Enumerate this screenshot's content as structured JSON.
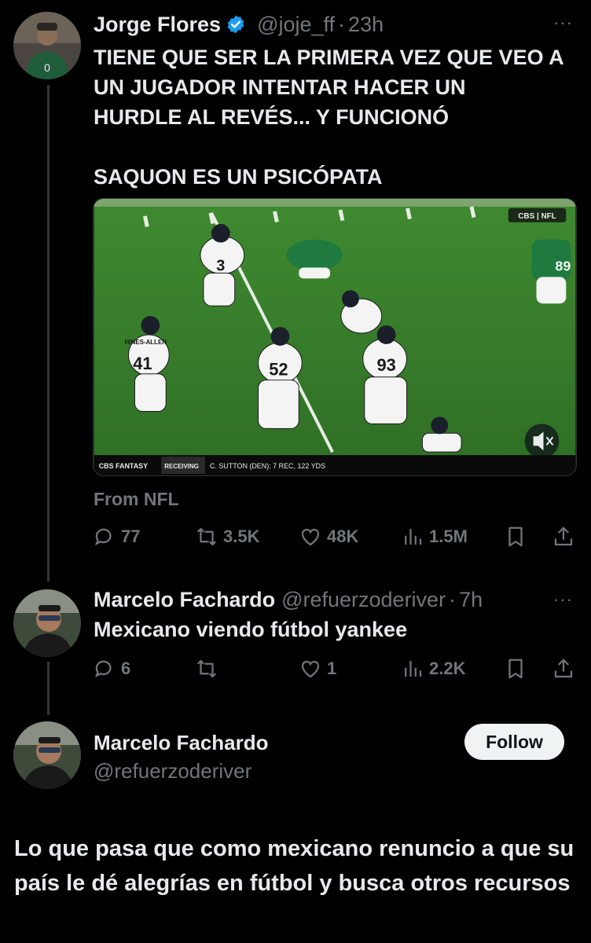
{
  "tweet": {
    "author_name": "Jorge Flores",
    "handle": "@joje_ff",
    "separator": "·",
    "time": "23h",
    "more": "···",
    "text": "TIENE QUE SER LA PRIMERA VEZ QUE VEO A\nUN JUGADOR INTENTAR HACER UN\nHURDLE AL REVÉS... Y FUNCIONÓ\n\nSAQUON ES UN PSICÓPATA",
    "media": {
      "network_bug": "CBS | NFL",
      "ticker_brand": "CBS FANTASY",
      "ticker_label": "RECEIVING",
      "ticker_text": "C. SUTTON (DEN): 7 REC, 122 YDS",
      "jersey_numbers": [
        "3",
        "41",
        "52",
        "93",
        "89"
      ],
      "nameplate": "HINES-ALLEN",
      "mute_icon": "speaker-mute-icon"
    },
    "source": "From NFL",
    "actions": {
      "replies": "77",
      "reposts": "3.5K",
      "likes": "48K",
      "views": "1.5M"
    }
  },
  "reply": {
    "author_name": "Marcelo Fachardo",
    "handle": "@refuerzoderiver",
    "separator": "·",
    "time": "7h",
    "more": "···",
    "text": "Mexicano viendo fútbol yankee",
    "actions": {
      "replies": "6",
      "reposts": "",
      "likes": "1",
      "views": "2.2K"
    }
  },
  "profile": {
    "name": "Marcelo Fachardo",
    "handle": "@refuerzoderiver",
    "follow_label": "Follow",
    "text": "Lo que pasa que como mexicano renuncio a que su país le dé alegrías en fútbol y busca otros recursos"
  },
  "colors": {
    "background": "#000000",
    "text_primary": "#e7e9ea",
    "text_secondary": "#71767b",
    "verified_blue": "#1d9bf0",
    "follow_bg": "#eff3f4"
  }
}
